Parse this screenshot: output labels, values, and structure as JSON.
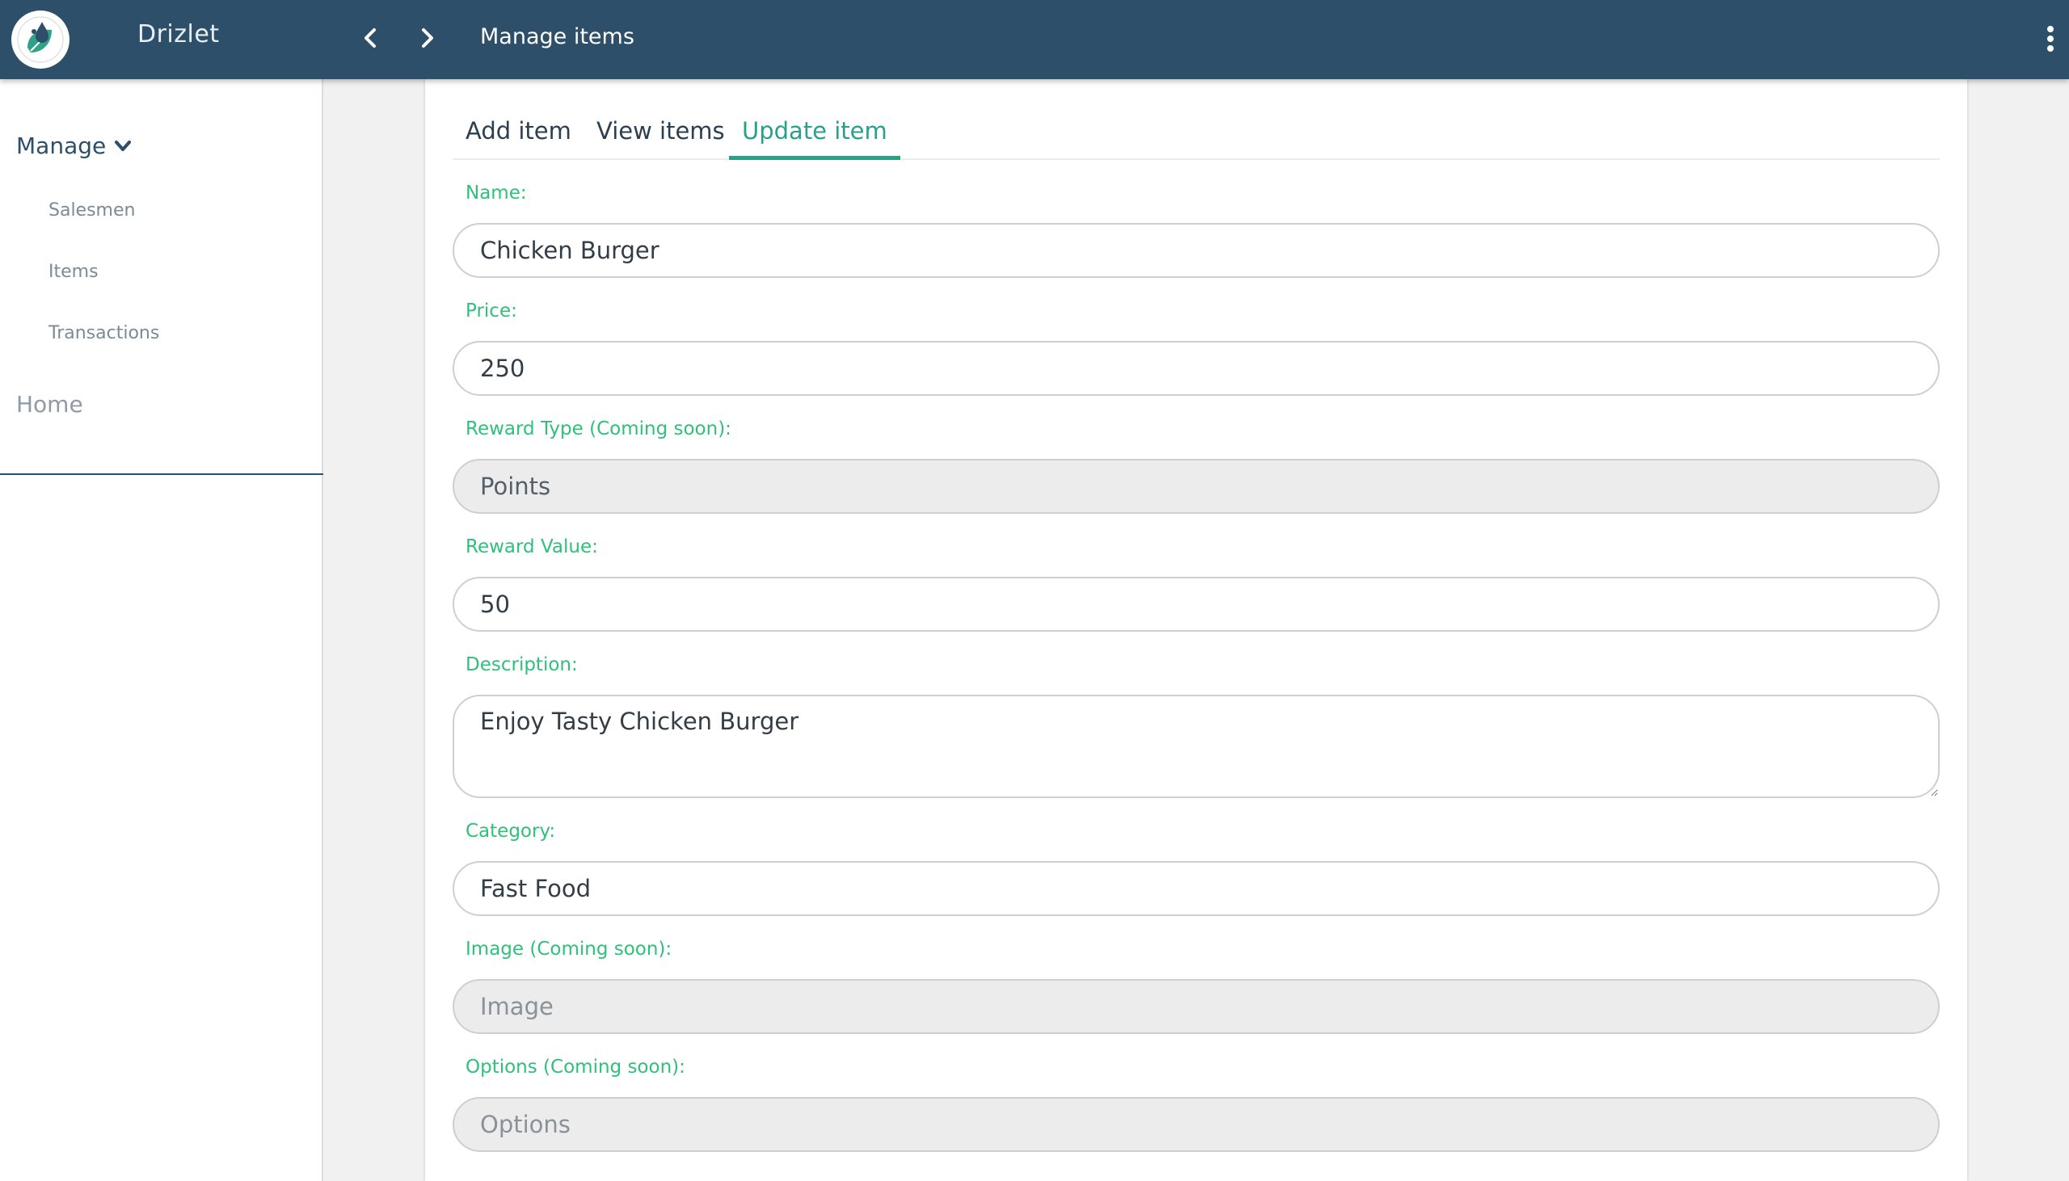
{
  "header": {
    "app_title": "Drizlet",
    "page_title": "Manage items",
    "brand_color": "#2d4f69"
  },
  "sidebar": {
    "manage_label": "Manage",
    "items": [
      {
        "label": "Salesmen"
      },
      {
        "label": "Items"
      },
      {
        "label": "Transactions"
      }
    ],
    "home_label": "Home"
  },
  "tabs": [
    {
      "label": "Add item",
      "active": false
    },
    {
      "label": "View items",
      "active": false
    },
    {
      "label": "Update item",
      "active": true
    }
  ],
  "form": {
    "name": {
      "label": "Name:",
      "value": "Chicken Burger"
    },
    "price": {
      "label": "Price:",
      "value": "250"
    },
    "reward_type": {
      "label": "Reward Type (Coming soon):",
      "value": "Points"
    },
    "reward_value": {
      "label": "Reward Value:",
      "value": "50"
    },
    "description": {
      "label": "Description:",
      "value": "Enjoy Tasty Chicken Burger"
    },
    "category": {
      "label": "Category:",
      "value": "Fast Food"
    },
    "image": {
      "label": "Image (Coming soon):",
      "placeholder": "Image"
    },
    "options": {
      "label": "Options (Coming soon):",
      "placeholder": "Options"
    }
  },
  "colors": {
    "accent": "#28a08a",
    "label_green": "#2fc07a"
  }
}
